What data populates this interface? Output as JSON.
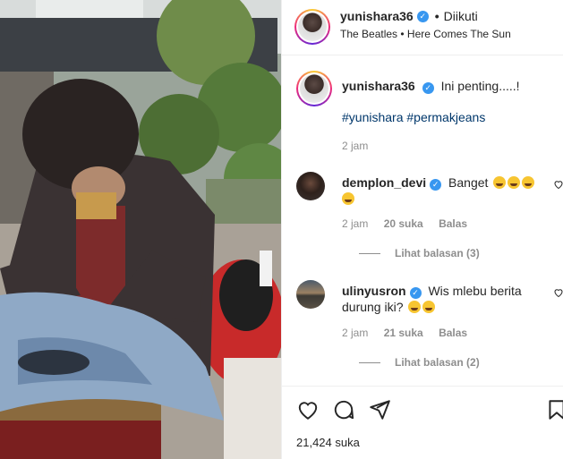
{
  "post": {
    "username": "yunishara36",
    "follow_state": "Diikuti",
    "dot": "•",
    "music": "The Beatles • Here Comes The Sun",
    "caption_text": "Ini penting.....!",
    "hashtags": "#yunishara #permakjeans",
    "caption_time": "2 jam"
  },
  "comments": [
    {
      "username": "demplon_devi",
      "text": "Banget",
      "time": "2 jam",
      "likes": "20 suka",
      "reply_label": "Balas",
      "view_replies": "Lihat balasan (3)"
    },
    {
      "username": "ulinyusron",
      "text": "Wis mlebu berita durung iki?",
      "time": "2 jam",
      "likes": "21 suka",
      "reply_label": "Balas",
      "view_replies": "Lihat balasan (2)"
    }
  ],
  "footer": {
    "likes_count": "21,424 suka"
  },
  "colors": {
    "verified": "#3897f0",
    "hashtag": "#00376b",
    "meta": "#8e8e8e"
  },
  "icons": [
    "heart-icon",
    "comment-icon",
    "share-icon",
    "bookmark-icon",
    "verified-badge-icon"
  ]
}
